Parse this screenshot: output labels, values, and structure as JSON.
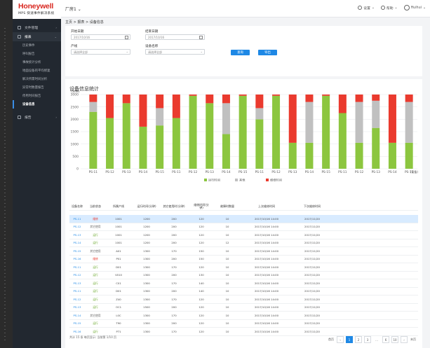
{
  "brand": {
    "name": "Honeywell",
    "subtitle": "MPS 快速事件解决系统"
  },
  "header": {
    "factory": "厂房1",
    "settings": "设置",
    "help": "帮助",
    "user": "Huihui"
  },
  "sidebar": {
    "items": [
      {
        "label": "文件管理",
        "state": "collapsed"
      },
      {
        "label": "报表",
        "state": "open"
      }
    ],
    "sub_items": [
      "历史事件",
      "呼叫报告",
      "事故统计分析",
      "地面设备的平均修复",
      "解决所需时间分析",
      "异常时数量报告",
      "停用时间报告",
      "设备信息"
    ],
    "active_sub": "设备信息",
    "bottom_item": "报告"
  },
  "breadcrumb": "主页 > 报表 > 设备信息",
  "filter": {
    "start_label": "开始日期",
    "start_value": "2017/10/16",
    "end_label": "结束日期",
    "end_value": "2017/10/16",
    "line_label": "产线",
    "line_value": "请选择全部",
    "device_label": "设备名称",
    "device_value": "请选择全部",
    "query_button": "查询",
    "export_button": "导出"
  },
  "panel_title": "设备信息统计",
  "chart_data": {
    "type": "bar",
    "ylabel": "(分钟)",
    "ylim": [
      0,
      3000
    ],
    "yticks": [
      0,
      500,
      1000,
      1500,
      2000,
      2500,
      3000
    ],
    "xlabel_extra": "(设备)",
    "categories": [
      "PS-11",
      "PS-12",
      "PS-13",
      "PS-14",
      "PS-15",
      "PS-11",
      "PS-12",
      "PS-13",
      "PS-14",
      "PS-15",
      "PS-11",
      "PS-12",
      "PS-13",
      "PS-14",
      "PS-15",
      "PS-11",
      "PS-12",
      "PS-13",
      "PS-14",
      "PS-15"
    ],
    "series": [
      {
        "name": "运行时间",
        "color": "#8cc63f",
        "values": [
          2300,
          2050,
          2650,
          1700,
          1750,
          2050,
          2950,
          2650,
          1400,
          2950,
          2000,
          2950,
          1050,
          1050,
          2950,
          2250,
          1050,
          1650,
          1050,
          1050
        ]
      },
      {
        "name": "其他",
        "color": "#c0c0c0",
        "values": [
          400,
          0,
          0,
          0,
          700,
          0,
          0,
          0,
          1250,
          0,
          450,
          0,
          0,
          1650,
          0,
          0,
          1650,
          1100,
          0,
          1650
        ]
      },
      {
        "name": "维修时间",
        "color": "#ea3a2e",
        "values": [
          300,
          950,
          350,
          1300,
          550,
          950,
          50,
          350,
          350,
          50,
          550,
          50,
          1950,
          300,
          50,
          750,
          300,
          250,
          1950,
          300
        ]
      }
    ]
  },
  "table": {
    "headers": [
      "设备名称",
      "当前状态",
      "所属产线",
      "运行时间(分钟)",
      "其它使用时(分钟)",
      "维修时间(分钟)",
      "故障时数量",
      "上次维修时间",
      "下次维修时间"
    ],
    "rows": [
      {
        "dev": "PS-11",
        "status": "维修",
        "line": "1001",
        "run": "1200",
        "other": "200",
        "repair": "120",
        "count": "10",
        "last": "2017/10/16 14:00",
        "next": "2017/11/20"
      },
      {
        "dev": "PS-12",
        "status": "其它使用",
        "line": "1001",
        "run": "1200",
        "other": "200",
        "repair": "120",
        "count": "10",
        "last": "2017/10/16 14:00",
        "next": "2017/11/20"
      },
      {
        "dev": "PS-13",
        "status": "运行",
        "line": "1001",
        "run": "1200",
        "other": "200",
        "repair": "120",
        "count": "10",
        "last": "2017/10/16 14:00",
        "next": "2017/11/20"
      },
      {
        "dev": "PS-14",
        "status": "运行",
        "line": "1001",
        "run": "1200",
        "other": "200",
        "repair": "120",
        "count": "12",
        "last": "2017/10/16 14:00",
        "next": "2017/11/20"
      },
      {
        "dev": "PS-15",
        "status": "其它使用",
        "line": "A01",
        "run": "1300",
        "other": "170",
        "repair": "150",
        "count": "10",
        "last": "2017/10/16 14:00",
        "next": "2017/11/20"
      },
      {
        "dev": "PS-16",
        "status": "维修",
        "line": "P01",
        "run": "1300",
        "other": "200",
        "repair": "150",
        "count": "10",
        "last": "2017/10/16 14:00",
        "next": "2017/11/20"
      },
      {
        "dev": "PS-11",
        "status": "运行",
        "line": "D01",
        "run": "1300",
        "other": "170",
        "repair": "120",
        "count": "10",
        "last": "2017/10/16 14:00",
        "next": "2017/11/20"
      },
      {
        "dev": "PS-12",
        "status": "运行",
        "line": "V010",
        "run": "1300",
        "other": "200",
        "repair": "130",
        "count": "10",
        "last": "2017/10/16 14:00",
        "next": "2017/11/20"
      },
      {
        "dev": "PS-13",
        "status": "运行",
        "line": "C01",
        "run": "1300",
        "other": "170",
        "repair": "140",
        "count": "10",
        "last": "2017/10/16 14:00",
        "next": "2017/11/20"
      },
      {
        "dev": "PS-11",
        "status": "运行",
        "line": "D01",
        "run": "1300",
        "other": "200",
        "repair": "140",
        "count": "10",
        "last": "2017/10/16 14:00",
        "next": "2017/11/20"
      },
      {
        "dev": "PS-12",
        "status": "运行",
        "line": "Z40",
        "run": "1300",
        "other": "170",
        "repair": "120",
        "count": "10",
        "last": "2017/10/16 14:00",
        "next": "2017/11/20"
      },
      {
        "dev": "PS-13",
        "status": "运行",
        "line": "OC1",
        "run": "1500",
        "other": "200",
        "repair": "120",
        "count": "10",
        "last": "2017/10/16 14:00",
        "next": "2017/11/20"
      },
      {
        "dev": "PS-14",
        "status": "其它使用",
        "line": "L0C",
        "run": "1300",
        "other": "170",
        "repair": "120",
        "count": "10",
        "last": "2017/10/16 14:00",
        "next": "2017/11/20"
      },
      {
        "dev": "PS-15",
        "status": "运行",
        "line": "T90",
        "run": "1300",
        "other": "200",
        "repair": "120",
        "count": "10",
        "last": "2017/10/16 14:00",
        "next": "2017/11/20"
      },
      {
        "dev": "PS-16",
        "status": "运行",
        "line": "P71",
        "run": "1300",
        "other": "170",
        "repair": "120",
        "count": "10",
        "last": "2017/10/16 14:00",
        "next": "2017/11/20"
      }
    ]
  },
  "footer": {
    "summary": "共计 15 条 每页显示: 当前第 1/10 页",
    "pages": [
      "首页",
      "1",
      "2",
      "3",
      "...",
      "6",
      "10",
      "末页"
    ],
    "active_page": "1",
    "prev": "‹",
    "next": "›"
  },
  "colors": {
    "accent": "#1e88e5",
    "running": "#8cc63f",
    "repair": "#ea3a2e",
    "other": "#c0c0c0"
  }
}
